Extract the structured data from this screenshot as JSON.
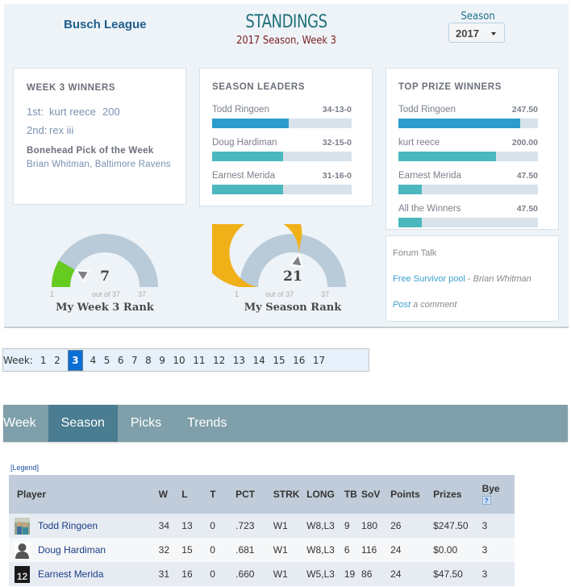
{
  "header": {
    "league_name": "Busch League",
    "title": "STANDINGS",
    "subtitle": "2017 Season, Week 3",
    "season_label": "Season",
    "season_selected": "2017"
  },
  "week_winners": {
    "title": "WEEK 3 WINNERS",
    "rows": [
      {
        "place": "1st:",
        "name": "kurt reece",
        "amount": "200"
      },
      {
        "place": "2nd:",
        "name": "rex iii",
        "amount": ""
      }
    ],
    "bonehead_title": "Bonehead Pick of the Week",
    "bonehead_text": "Brian Whitman, Baltimore Ravens"
  },
  "season_leaders": {
    "title": "SEASON LEADERS",
    "items": [
      {
        "name": "Todd Ringoen",
        "value": "34-13-0",
        "fraction": 0.55
      },
      {
        "name": "Doug Hardiman",
        "value": "32-15-0",
        "fraction": 0.51
      },
      {
        "name": "Earnest Merida",
        "value": "31-16-0",
        "fraction": 0.51
      }
    ]
  },
  "top_prize_winners": {
    "title": "TOP PRIZE WINNERS",
    "items": [
      {
        "name": "Todd Ringoen",
        "value": "247.50",
        "fraction": 0.87
      },
      {
        "name": "kurt reece",
        "value": "200.00",
        "fraction": 0.7
      },
      {
        "name": "Earnest Merida",
        "value": "47.50",
        "fraction": 0.165
      },
      {
        "name": "All the Winners",
        "value": "47.50",
        "fraction": 0.165
      }
    ]
  },
  "forum": {
    "title": "Forum Talk",
    "topic": "Free Survivor pool",
    "separator": " - ",
    "author": "Brian Whitman",
    "post_link": "Post",
    "post_suffix": " a comment"
  },
  "gauges": [
    {
      "value": "7",
      "out_of": "out of 37",
      "min": "1",
      "max": "37",
      "caption": "My Week 3 Rank",
      "rank": 7,
      "total": 37,
      "color": "#66cc22"
    },
    {
      "value": "21",
      "out_of": "out of 37",
      "min": "1",
      "max": "37",
      "caption": "My Season Rank",
      "rank": 21,
      "total": 37,
      "color": "#f0b018"
    }
  ],
  "weeks": {
    "label": "Week:",
    "items": [
      "1",
      "2",
      "3",
      "4",
      "5",
      "6",
      "7",
      "8",
      "9",
      "10",
      "11",
      "12",
      "13",
      "14",
      "15",
      "16",
      "17"
    ],
    "active": "3"
  },
  "tabs": [
    {
      "label": "Week",
      "active": false
    },
    {
      "label": "Season",
      "active": true
    },
    {
      "label": "Picks",
      "active": false
    },
    {
      "label": "Trends",
      "active": false
    }
  ],
  "legend_link": "[Legend]",
  "table": {
    "columns": [
      "Player",
      "W",
      "L",
      "T",
      "PCT",
      "STRK",
      "LONG",
      "TB",
      "SoV",
      "Points",
      "Prizes",
      "Bye"
    ],
    "rows": [
      {
        "player": "Todd Ringoen",
        "avatar": "photo-avatar",
        "W": "34",
        "L": "13",
        "T": "0",
        "PCT": ".723",
        "STRK": "W1",
        "LONG": "W8,L3",
        "TB": "9",
        "SoV": "180",
        "Points": "26",
        "Prizes": "$247.50",
        "Bye": "3"
      },
      {
        "player": "Doug Hardiman",
        "avatar": "default-silhouette-avatar",
        "W": "32",
        "L": "15",
        "T": "0",
        "PCT": ".681",
        "STRK": "W1",
        "LONG": "W8,L3",
        "TB": "6",
        "SoV": "116",
        "Points": "24",
        "Prizes": "$0.00",
        "Bye": "3"
      },
      {
        "player": "Earnest Merida",
        "avatar": "jersey-12-avatar",
        "W": "31",
        "L": "16",
        "T": "0",
        "PCT": ".660",
        "STRK": "W1",
        "LONG": "W5,L3",
        "TB": "19",
        "SoV": "86",
        "Points": "24",
        "Prizes": "$47.50",
        "Bye": "3"
      }
    ]
  },
  "colors": {
    "primary_bar": "#2c9ccc",
    "secondary_bar": "#4bb8be",
    "tab_bar": "#7fa0aa",
    "tab_active": "#4a7d91",
    "week_active": "#0a6fd6"
  }
}
